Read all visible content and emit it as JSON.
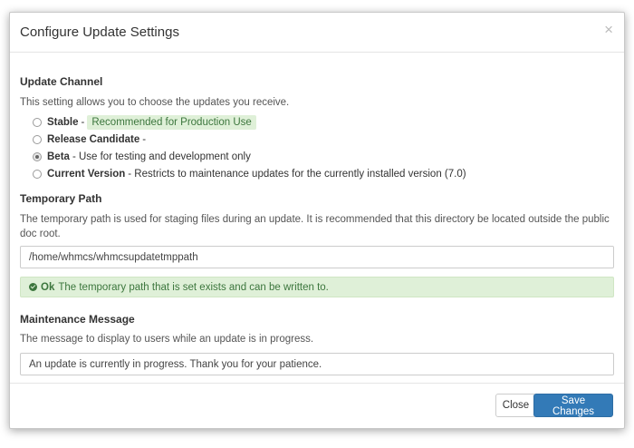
{
  "modal": {
    "title": "Configure Update Settings",
    "close_glyph": "×"
  },
  "update_channel": {
    "label": "Update Channel",
    "help": "This setting allows you to choose the updates you receive.",
    "options": [
      {
        "name": "Stable",
        "desc": "-",
        "badge": "Recommended for Production Use",
        "selected": false
      },
      {
        "name": "Release Candidate",
        "desc": "-",
        "selected": false
      },
      {
        "name": "Beta",
        "desc": "- Use for testing and development only",
        "selected": true
      },
      {
        "name": "Current Version",
        "desc": "- Restricts to maintenance updates for the currently installed version (7.0)",
        "selected": false
      }
    ]
  },
  "temp_path": {
    "label": "Temporary Path",
    "help": "The temporary path is used for staging files during an update. It is recommended that this directory be located outside the public doc root.",
    "value": "/home/whmcs/whmcsupdatetmppath",
    "alert_strong": "Ok",
    "alert_text": "The temporary path that is set exists and can be written to."
  },
  "maintenance": {
    "label": "Maintenance Message",
    "help": "The message to display to users while an update is in progress.",
    "value": "An update is currently in progress. Thank you for your patience."
  },
  "footer": {
    "close_label": "Close",
    "save_label": "Save Changes"
  },
  "colors": {
    "primary": "#337ab7",
    "success_bg": "#dff0d8",
    "success_text": "#3c763d"
  },
  "icons": {
    "close": "close-icon",
    "ok": "check-circle-icon"
  }
}
